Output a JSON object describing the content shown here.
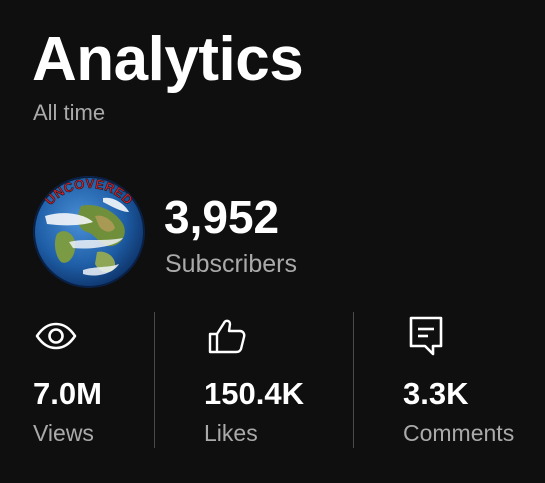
{
  "header": {
    "title": "Analytics",
    "period": "All time"
  },
  "channel": {
    "avatar_icon": "channel-avatar-globe",
    "avatar_text": "UNCOVERED",
    "subscribers_value": "3,952",
    "subscribers_label": "Subscribers"
  },
  "stats": [
    {
      "icon": "eye-icon",
      "value": "7.0M",
      "label": "Views"
    },
    {
      "icon": "thumbs-up-icon",
      "value": "150.4K",
      "label": "Likes"
    },
    {
      "icon": "comment-icon",
      "value": "3.3K",
      "label": "Comments"
    }
  ],
  "colors": {
    "background": "#0f0f0f",
    "primary_text": "#ffffff",
    "secondary_text": "#aaaaaa",
    "divider": "#4a4a4a",
    "avatar_text": "#d21f2b"
  }
}
